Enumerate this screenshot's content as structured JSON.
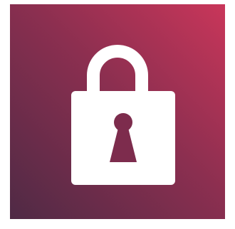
{
  "app_icon": {
    "icon": "padlock-icon",
    "colors": {
      "gradient_start": "#4f2a45",
      "gradient_mid": "#8c2f50",
      "gradient_end": "#c9365a",
      "glyph": "#ffffff",
      "keyhole": "#7d2c4d",
      "page_background": "#ffffff"
    }
  }
}
